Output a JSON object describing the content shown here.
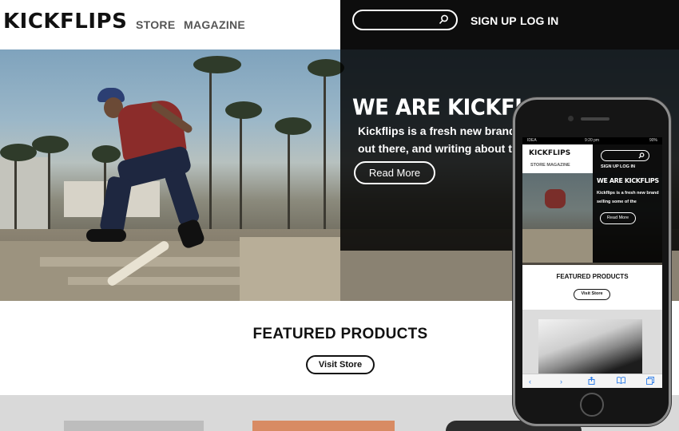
{
  "header": {
    "logo": "KICKFLIPS",
    "nav": [
      {
        "label": "STORE"
      },
      {
        "label": "MAGAZINE"
      }
    ],
    "search": {
      "placeholder": ""
    },
    "auth": [
      {
        "label": "SIGN UP"
      },
      {
        "label": "LOG IN"
      }
    ]
  },
  "hero": {
    "title": "WE ARE KICKFLIPS",
    "text_line1": "Kickflips is a fresh new brand s",
    "text_line2": "out there, and writing about the",
    "button": "Read More"
  },
  "featured": {
    "title": "FEATURED PRODUCTS",
    "button": "Visit Store"
  },
  "phone": {
    "status": {
      "carrier": "IDEA",
      "time": "9:20 pm",
      "battery": "90%"
    },
    "logo": "KICKFLIPS",
    "nav": "STORE MAGAZINE",
    "auth": "SIGN UP  LOG IN",
    "hero_title": "WE ARE KICKFLIPS",
    "hero_text": "Kickflips is a fresh new brand selling some of the",
    "hero_button": "Read More",
    "featured_title": "FEATURED PRODUCTS",
    "featured_button": "Visit Store",
    "toolbar": [
      "back-icon",
      "forward-icon",
      "share-icon",
      "bookmarks-icon",
      "tabs-icon"
    ]
  },
  "colors": {
    "dark": "#0d0d0d",
    "white": "#ffffff",
    "band": "#d9d9d9",
    "ios_blue": "#2f7ee8"
  }
}
